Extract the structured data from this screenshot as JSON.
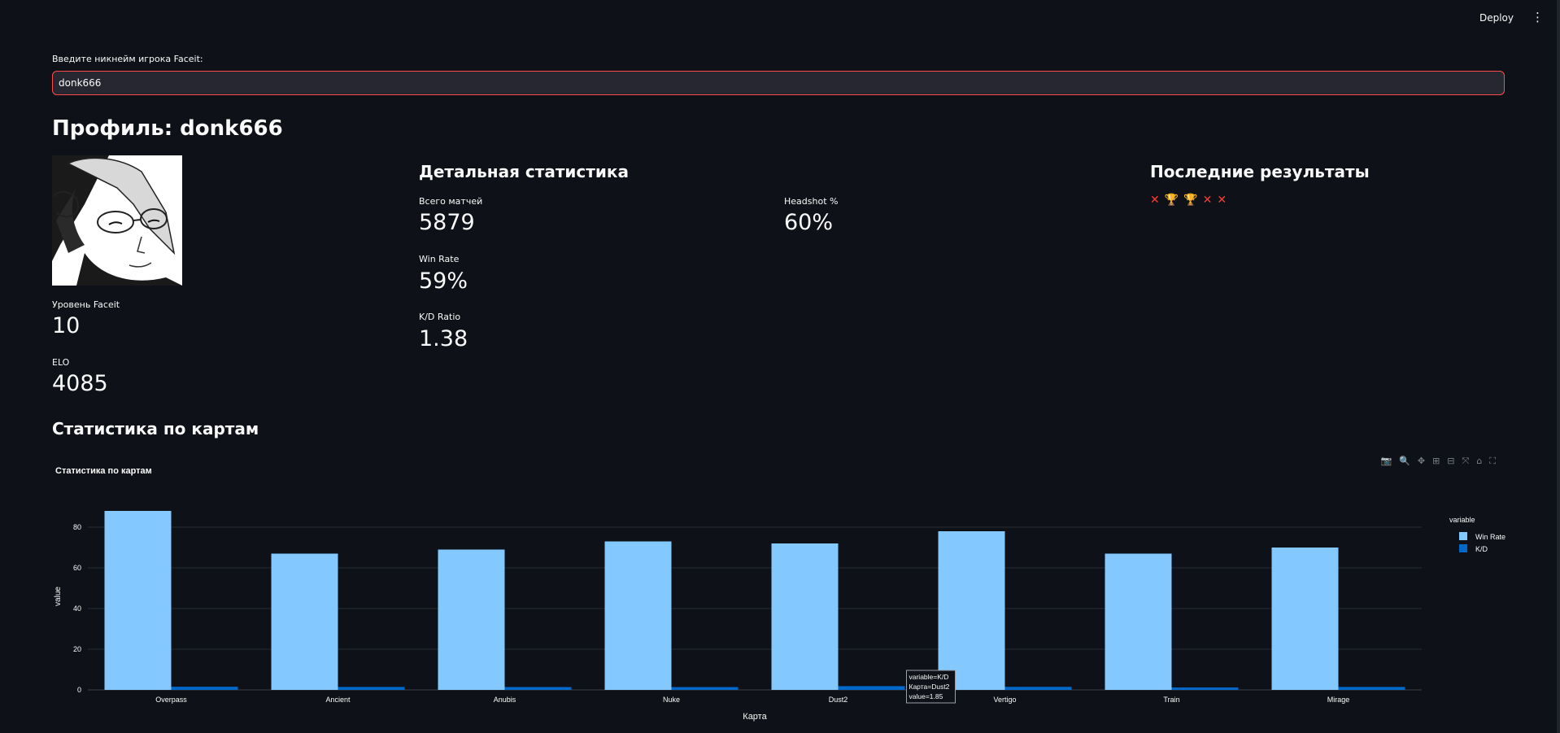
{
  "topbar": {
    "deploy_label": "Deploy",
    "menu_icon": "⋮"
  },
  "search": {
    "label": "Введите никнейм игрока Faceit:",
    "value": "donk666"
  },
  "profile": {
    "title": "Профиль: donk666",
    "level_label": "Уровень Faceit",
    "level_value": "10",
    "elo_label": "ELO",
    "elo_value": "4085"
  },
  "stats": {
    "heading": "Детальная статистика",
    "matches_label": "Всего матчей",
    "matches_value": "5879",
    "winrate_label": "Win Rate",
    "winrate_value": "59%",
    "kd_label": "K/D Ratio",
    "kd_value": "1.38",
    "hs_label": "Headshot %",
    "hs_value": "60%"
  },
  "recent": {
    "heading": "Последние результаты",
    "results": [
      "loss",
      "win",
      "win",
      "loss",
      "loss"
    ]
  },
  "maps_section": {
    "heading": "Статистика по картам"
  },
  "colors": {
    "win_rate": "#83c9ff",
    "kd": "#0068c9",
    "loss": "#ff3b30",
    "win": "#f5a623",
    "background": "#0e1117"
  },
  "chart_data": {
    "type": "bar",
    "title": "Статистика по картам",
    "xlabel": "Карта",
    "ylabel": "value",
    "ylim": [
      0,
      92
    ],
    "yticks": [
      0,
      20,
      40,
      60,
      80
    ],
    "categories": [
      "Overpass",
      "Ancient",
      "Anubis",
      "Nuke",
      "Dust2",
      "Vertigo",
      "Train",
      "Mirage"
    ],
    "legend_title": "variable",
    "legend_position": "top-right",
    "grid": true,
    "series": [
      {
        "name": "Win Rate",
        "values": [
          88,
          67,
          69,
          73,
          72,
          78,
          67,
          70
        ]
      },
      {
        "name": "K/D",
        "values": [
          1.55,
          1.45,
          1.4,
          1.38,
          1.85,
          1.5,
          1.2,
          1.45
        ]
      }
    ],
    "tooltip": {
      "lines": [
        "variable=K/D",
        "Карта=Dust2",
        "value=1.85"
      ]
    }
  }
}
